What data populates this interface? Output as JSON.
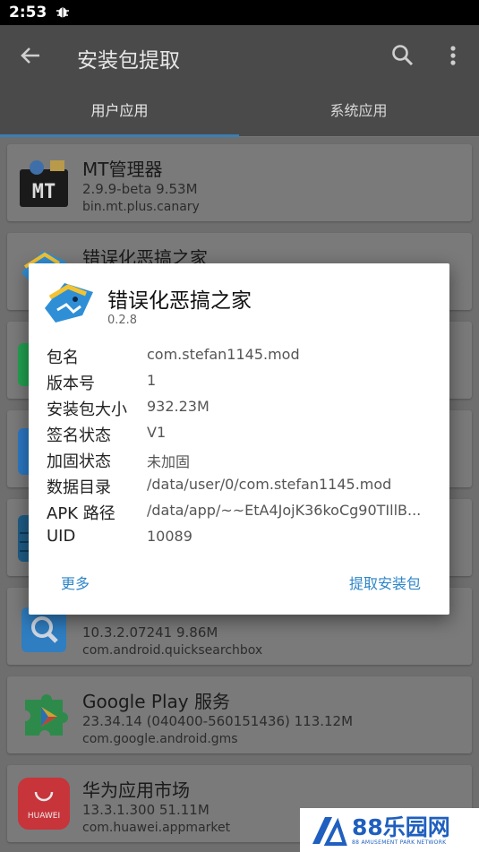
{
  "status_bar": {
    "time": "2:53",
    "bug_icon": "bug-icon"
  },
  "app_bar": {
    "title": "安装包提取",
    "back_icon": "arrow-back-icon",
    "search_icon": "search-icon",
    "more_icon": "more-vert-icon"
  },
  "tabs": [
    {
      "label": "用户应用",
      "active": true
    },
    {
      "label": "系统应用",
      "active": false
    }
  ],
  "apps": [
    {
      "name": "MT管理器",
      "version": "2.9.9-beta   9.53M",
      "package": "bin.mt.plus.canary",
      "icon": "mt-manager-icon"
    },
    {
      "name": "错误化恶搞之家",
      "version": "",
      "package": "",
      "icon": "fnf-icon"
    },
    {
      "name": "",
      "version": "",
      "package": "",
      "icon": "green-app-icon"
    },
    {
      "name": "",
      "version": "",
      "package": "",
      "icon": "blue-app-icon"
    },
    {
      "name": "",
      "version": "",
      "package": "",
      "icon": "stack-app-icon"
    },
    {
      "name": "",
      "version": "10.3.2.07241   9.86M",
      "package": "com.android.quicksearchbox",
      "icon": "quicksearch-icon"
    },
    {
      "name": "Google Play 服务",
      "version": "23.34.14 (040400-560151436)   113.12M",
      "package": "com.google.android.gms",
      "icon": "google-play-services-icon"
    },
    {
      "name": "华为应用市场",
      "version": "13.3.1.300   51.11M",
      "package": "com.huawei.appmarket",
      "icon": "huawei-appgallery-icon"
    }
  ],
  "huawei_icon_text": "HUAWEI",
  "dialog": {
    "app_name": "错误化恶搞之家",
    "version": "0.2.8",
    "rows": [
      {
        "key": "包名",
        "value": "com.stefan1145.mod"
      },
      {
        "key": "版本号",
        "value": "1"
      },
      {
        "key": "安装包大小",
        "value": "932.23M"
      },
      {
        "key": "签名状态",
        "value": "V1"
      },
      {
        "key": "加固状态",
        "value": "未加固"
      },
      {
        "key": "数据目录",
        "value": "/data/user/0/com.stefan1145.mod"
      },
      {
        "key": "APK 路径",
        "value": "/data/app/~~EtA4JojK36koCg90TIllB..."
      },
      {
        "key": "UID",
        "value": "10089"
      }
    ],
    "more_label": "更多",
    "extract_label": "提取安装包"
  },
  "watermark": {
    "text": "88乐园网",
    "subtext": "88 AMUSEMENT PARK NETWORK"
  }
}
